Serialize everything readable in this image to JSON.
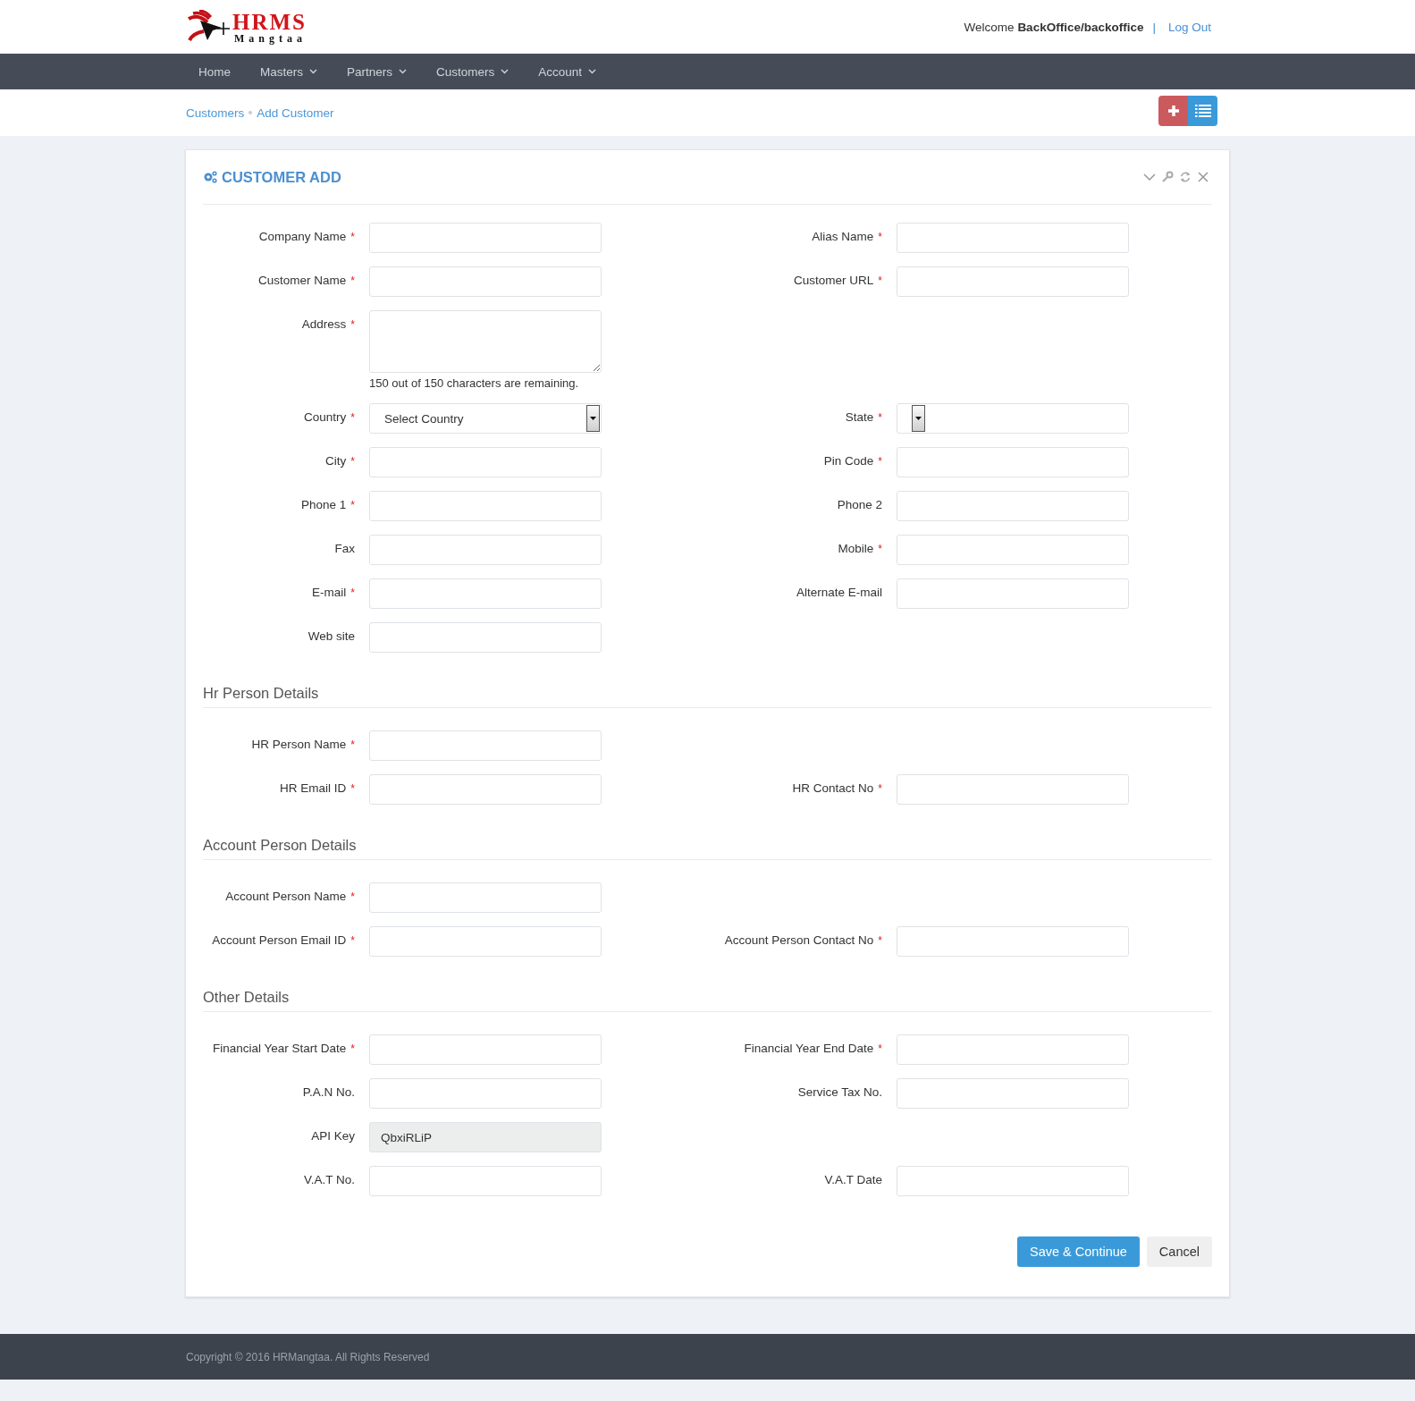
{
  "header": {
    "logo": {
      "title": "HRMS",
      "subtitle": "Mangtaa"
    },
    "welcome": "Welcome **BackOffice/backoffice**",
    "separator": "|",
    "logout": "Log Out"
  },
  "nav": [
    {
      "label": "Home",
      "dropdown": false
    },
    {
      "label": "Masters",
      "dropdown": true
    },
    {
      "label": "Partners",
      "dropdown": true
    },
    {
      "label": "Customers",
      "dropdown": true
    },
    {
      "label": "Account",
      "dropdown": true
    }
  ],
  "breadcrumb": [
    "Customers",
    "Add Customer"
  ],
  "actions": [
    {
      "kind": "add"
    },
    {
      "kind": "list"
    }
  ],
  "panel": {
    "title": "CUSTOMER ADD",
    "tools": [
      {
        "kind": "collapse"
      },
      {
        "kind": "settings"
      },
      {
        "kind": "refresh"
      },
      {
        "kind": "close"
      }
    ],
    "sections": [
      {
        "rows": [
          {
            "left": {
              "label": "Company Name",
              "required_mark": "*",
              "kind": "text"
            },
            "right": {
              "label": "Alias Name",
              "required_mark": "*",
              "kind": "text"
            }
          },
          {
            "left": {
              "label": "Customer Name",
              "required_mark": "*",
              "kind": "text"
            },
            "right": {
              "label": "Customer URL",
              "required_mark": "*",
              "kind": "text"
            }
          },
          {
            "left": {
              "label": "Address",
              "required_mark": "*",
              "kind": "textarea",
              "hint": "150 out of 150 characters are remaining."
            }
          },
          {
            "left": {
              "label": "Country",
              "required_mark": "*",
              "kind": "select",
              "value": "Select Country"
            },
            "right": {
              "label": "State",
              "required_mark": "*",
              "kind": "select"
            }
          },
          {
            "left": {
              "label": "City",
              "required_mark": "*",
              "kind": "text"
            },
            "right": {
              "label": "Pin Code",
              "required_mark": "*",
              "kind": "text"
            }
          },
          {
            "left": {
              "label": "Phone 1",
              "required_mark": "*",
              "kind": "text"
            },
            "right": {
              "label": "Phone 2",
              "kind": "text"
            }
          },
          {
            "left": {
              "label": "Fax",
              "kind": "text"
            },
            "right": {
              "label": "Mobile",
              "required_mark": "*",
              "kind": "text"
            }
          },
          {
            "left": {
              "label": "E-mail",
              "required_mark": "*",
              "kind": "text"
            },
            "right": {
              "label": "Alternate E-mail",
              "kind": "text"
            }
          },
          {
            "left": {
              "label": "Web site",
              "kind": "text"
            }
          }
        ]
      },
      {
        "title": "Hr Person Details",
        "rows": [
          {
            "left": {
              "label": "HR Person Name",
              "required_mark": "*",
              "kind": "text"
            }
          },
          {
            "left": {
              "label": "HR Email ID",
              "required_mark": "*",
              "kind": "text"
            },
            "right": {
              "label": "HR Contact No",
              "required_mark": "*",
              "kind": "text"
            }
          }
        ]
      },
      {
        "title": "Account Person Details",
        "rows": [
          {
            "left": {
              "label": "Account Person Name",
              "required_mark": "*",
              "kind": "text"
            }
          },
          {
            "left": {
              "label": "Account Person Email ID",
              "required_mark": "*",
              "kind": "text"
            },
            "right": {
              "label": "Account Person Contact No",
              "required_mark": "*",
              "kind": "text"
            }
          }
        ]
      },
      {
        "title": "Other Details",
        "rows": [
          {
            "left": {
              "label": "Financial Year Start Date",
              "required_mark": "*",
              "kind": "text"
            },
            "right": {
              "label": "Financial Year End Date",
              "required_mark": "*",
              "kind": "text"
            }
          },
          {
            "left": {
              "label": "P.A.N No.",
              "kind": "text"
            },
            "right": {
              "label": "Service Tax No.",
              "kind": "text"
            }
          },
          {
            "left": {
              "label": "API Key",
              "kind": "text",
              "value": "QbxiRLiP",
              "disabled": true
            }
          },
          {
            "left": {
              "label": "V.A.T No.",
              "kind": "text"
            },
            "right": {
              "label": "V.A.T Date",
              "kind": "text"
            }
          }
        ]
      }
    ],
    "buttons": [
      {
        "label": "Save & Continue",
        "kind": "primary"
      },
      {
        "label": "Cancel",
        "kind": "default"
      }
    ]
  },
  "footer": "Copyright © 2016 HRMangtaa. All Rights Reserved"
}
